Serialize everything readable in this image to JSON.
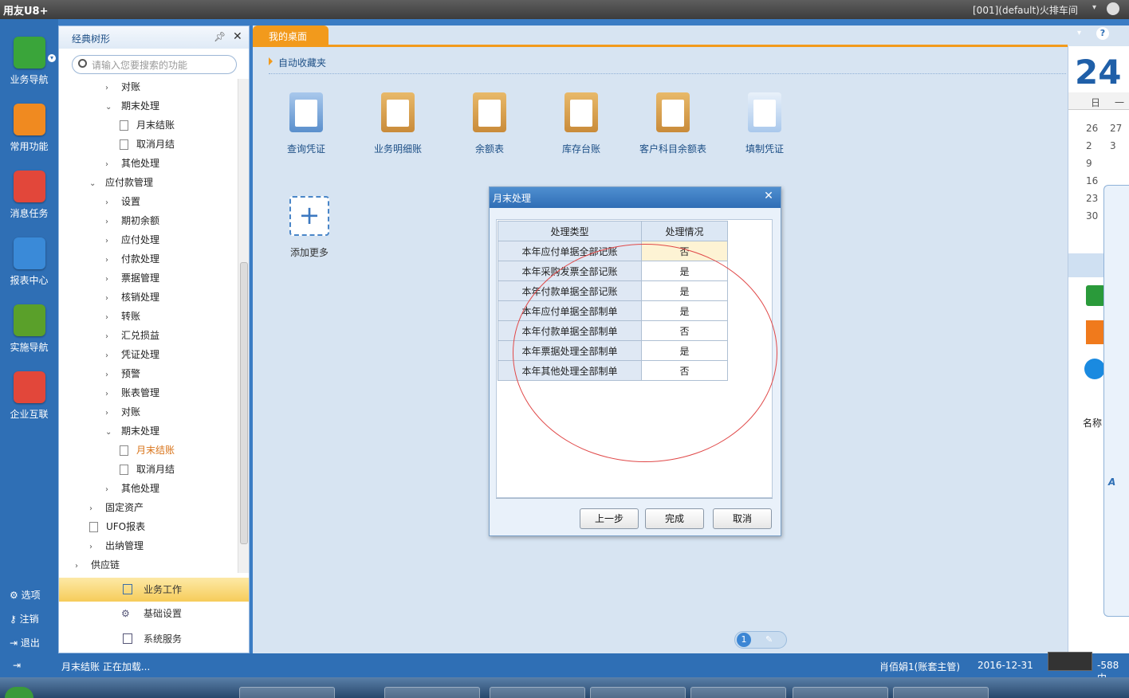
{
  "topbar": {
    "logo": "用友U8+",
    "account": "[001](default)火排车间"
  },
  "leftnav": [
    {
      "label": "业务导航",
      "icon": "tree-icon",
      "color": "#3aa53a"
    },
    {
      "label": "常用功能",
      "icon": "star-icon",
      "color": "#f08a20"
    },
    {
      "label": "消息任务",
      "icon": "mail-icon",
      "color": "#e2473a"
    },
    {
      "label": "报表中心",
      "icon": "report-icon",
      "color": "#3a8ad8"
    },
    {
      "label": "实施导航",
      "icon": "compass-icon",
      "color": "#5aa02a"
    },
    {
      "label": "企业互联",
      "icon": "link-icon",
      "color": "#e2473a"
    }
  ],
  "leftbottom": {
    "options": "选项",
    "logout": "注销",
    "exit": "退出"
  },
  "tree": {
    "title": "经典树形",
    "search_placeholder": "请输入您要搜索的功能",
    "rows": [
      {
        "label": "对账",
        "level": 2,
        "type": "collapsed"
      },
      {
        "label": "期末处理",
        "level": 2,
        "type": "expanded"
      },
      {
        "label": "月末结账",
        "level": 3,
        "type": "leaf"
      },
      {
        "label": "取消月结",
        "level": 3,
        "type": "leaf"
      },
      {
        "label": "其他处理",
        "level": 2,
        "type": "collapsed"
      },
      {
        "label": "应付款管理",
        "level": 1,
        "type": "expanded"
      },
      {
        "label": "设置",
        "level": 2,
        "type": "collapsed"
      },
      {
        "label": "期初余额",
        "level": 2,
        "type": "collapsed"
      },
      {
        "label": "应付处理",
        "level": 2,
        "type": "collapsed"
      },
      {
        "label": "付款处理",
        "level": 2,
        "type": "collapsed"
      },
      {
        "label": "票据管理",
        "level": 2,
        "type": "collapsed"
      },
      {
        "label": "核销处理",
        "level": 2,
        "type": "collapsed"
      },
      {
        "label": "转账",
        "level": 2,
        "type": "collapsed"
      },
      {
        "label": "汇兑损益",
        "level": 2,
        "type": "collapsed"
      },
      {
        "label": "凭证处理",
        "level": 2,
        "type": "collapsed"
      },
      {
        "label": "预警",
        "level": 2,
        "type": "collapsed"
      },
      {
        "label": "账表管理",
        "level": 2,
        "type": "collapsed"
      },
      {
        "label": "对账",
        "level": 2,
        "type": "collapsed"
      },
      {
        "label": "期末处理",
        "level": 2,
        "type": "expanded"
      },
      {
        "label": "月末结账",
        "level": 3,
        "type": "leaf",
        "active": true
      },
      {
        "label": "取消月结",
        "level": 3,
        "type": "leaf"
      },
      {
        "label": "其他处理",
        "level": 2,
        "type": "collapsed"
      },
      {
        "label": "固定资产",
        "level": 1,
        "type": "collapsed"
      },
      {
        "label": "UFO报表",
        "level": 1,
        "type": "leaf"
      },
      {
        "label": "出纳管理",
        "level": 1,
        "type": "collapsed"
      },
      {
        "label": "供应链",
        "level": 0,
        "type": "collapsed"
      }
    ],
    "bottom": [
      "业务工作",
      "基础设置",
      "系统服务"
    ]
  },
  "desktop": {
    "tab": "我的桌面",
    "favorites": "自动收藏夹",
    "apps": [
      "查询凭证",
      "业务明细账",
      "余额表",
      "库存台账",
      "客户科目余额表",
      "填制凭证"
    ],
    "add_more": "添加更多"
  },
  "calendar": {
    "day": "24",
    "weekday_header": [
      "日",
      "一"
    ],
    "rows": [
      [
        "26",
        "27"
      ],
      [
        "2",
        "3"
      ],
      [
        "9",
        ""
      ],
      [
        "16",
        ""
      ],
      [
        "23",
        ""
      ],
      [
        "30",
        ""
      ]
    ],
    "side_label": "名称"
  },
  "dialog": {
    "title": "月末处理",
    "headers": [
      "处理类型",
      "处理情况"
    ],
    "rows": [
      {
        "type": "本年应付单据全部记账",
        "status": "否"
      },
      {
        "type": "本年采购发票全部记账",
        "status": "是"
      },
      {
        "type": "本年付款单据全部记账",
        "status": "是"
      },
      {
        "type": "本年应付单据全部制单",
        "status": "是"
      },
      {
        "type": "本年付款单据全部制单",
        "status": "否"
      },
      {
        "type": "本年票据处理全部制单",
        "status": "是"
      },
      {
        "type": "本年其他处理全部制单",
        "status": "否"
      }
    ],
    "buttons": {
      "prev": "上一步",
      "finish": "完成",
      "cancel": "取消"
    }
  },
  "pager": {
    "page": "1"
  },
  "status": {
    "left": "月末结账 正在加载...",
    "user": "肖佰娟1(账套主管)",
    "date": "2016-12-31",
    "extra": "-588 中"
  }
}
